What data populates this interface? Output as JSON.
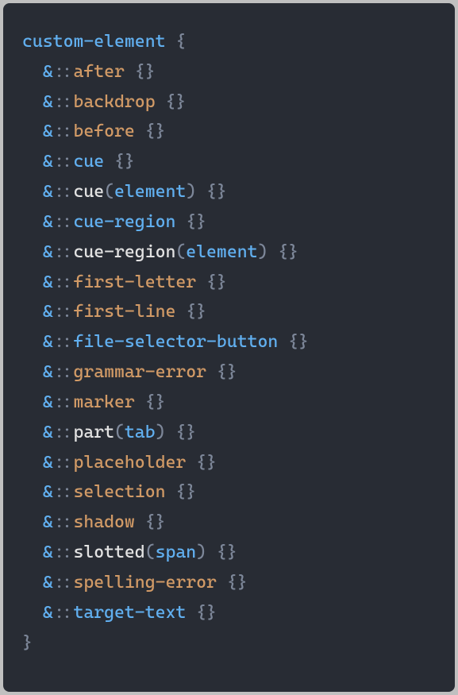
{
  "code": {
    "selector": "custom-element",
    "lines": [
      {
        "type": "pseudo",
        "amp": "&",
        "sep": "::",
        "name": "after",
        "suffix": " {}"
      },
      {
        "type": "pseudo",
        "amp": "&",
        "sep": "::",
        "name": "backdrop",
        "suffix": " {}"
      },
      {
        "type": "pseudo",
        "amp": "&",
        "sep": "::",
        "name": "before",
        "suffix": " {}"
      },
      {
        "type": "pseudo-kw",
        "amp": "&",
        "sep": "::",
        "name": "cue",
        "suffix": " {}"
      },
      {
        "type": "func",
        "amp": "&",
        "sep": "::",
        "name": "cue",
        "arg": "element",
        "suffix": " {}"
      },
      {
        "type": "pseudo-kw",
        "amp": "&",
        "sep": "::",
        "name": "cue-region",
        "suffix": " {}"
      },
      {
        "type": "func",
        "amp": "&",
        "sep": "::",
        "name": "cue-region",
        "arg": "element",
        "suffix": " {}"
      },
      {
        "type": "pseudo",
        "amp": "&",
        "sep": "::",
        "name": "first-letter",
        "suffix": " {}"
      },
      {
        "type": "pseudo",
        "amp": "&",
        "sep": "::",
        "name": "first-line",
        "suffix": " {}"
      },
      {
        "type": "pseudo-kw",
        "amp": "&",
        "sep": "::",
        "name": "file-selector-button",
        "suffix": " {}"
      },
      {
        "type": "pseudo",
        "amp": "&",
        "sep": "::",
        "name": "grammar-error",
        "suffix": " {}"
      },
      {
        "type": "pseudo",
        "amp": "&",
        "sep": "::",
        "name": "marker",
        "suffix": " {}"
      },
      {
        "type": "func",
        "amp": "&",
        "sep": "::",
        "name": "part",
        "arg": "tab",
        "suffix": " {}"
      },
      {
        "type": "pseudo",
        "amp": "&",
        "sep": "::",
        "name": "placeholder",
        "suffix": " {}"
      },
      {
        "type": "pseudo",
        "amp": "&",
        "sep": "::",
        "name": "selection",
        "suffix": " {}"
      },
      {
        "type": "pseudo",
        "amp": "&",
        "sep": "::",
        "name": "shadow",
        "suffix": " {}"
      },
      {
        "type": "func",
        "amp": "&",
        "sep": "::",
        "name": "slotted",
        "arg": "span",
        "suffix": " {}"
      },
      {
        "type": "pseudo",
        "amp": "&",
        "sep": "::",
        "name": "spelling-error",
        "suffix": " {}"
      },
      {
        "type": "pseudo-kw",
        "amp": "&",
        "sep": "::",
        "name": "target-text",
        "suffix": " {}"
      }
    ],
    "open_brace": " {",
    "close_brace": "}",
    "paren_open": "(",
    "paren_close": ")"
  }
}
